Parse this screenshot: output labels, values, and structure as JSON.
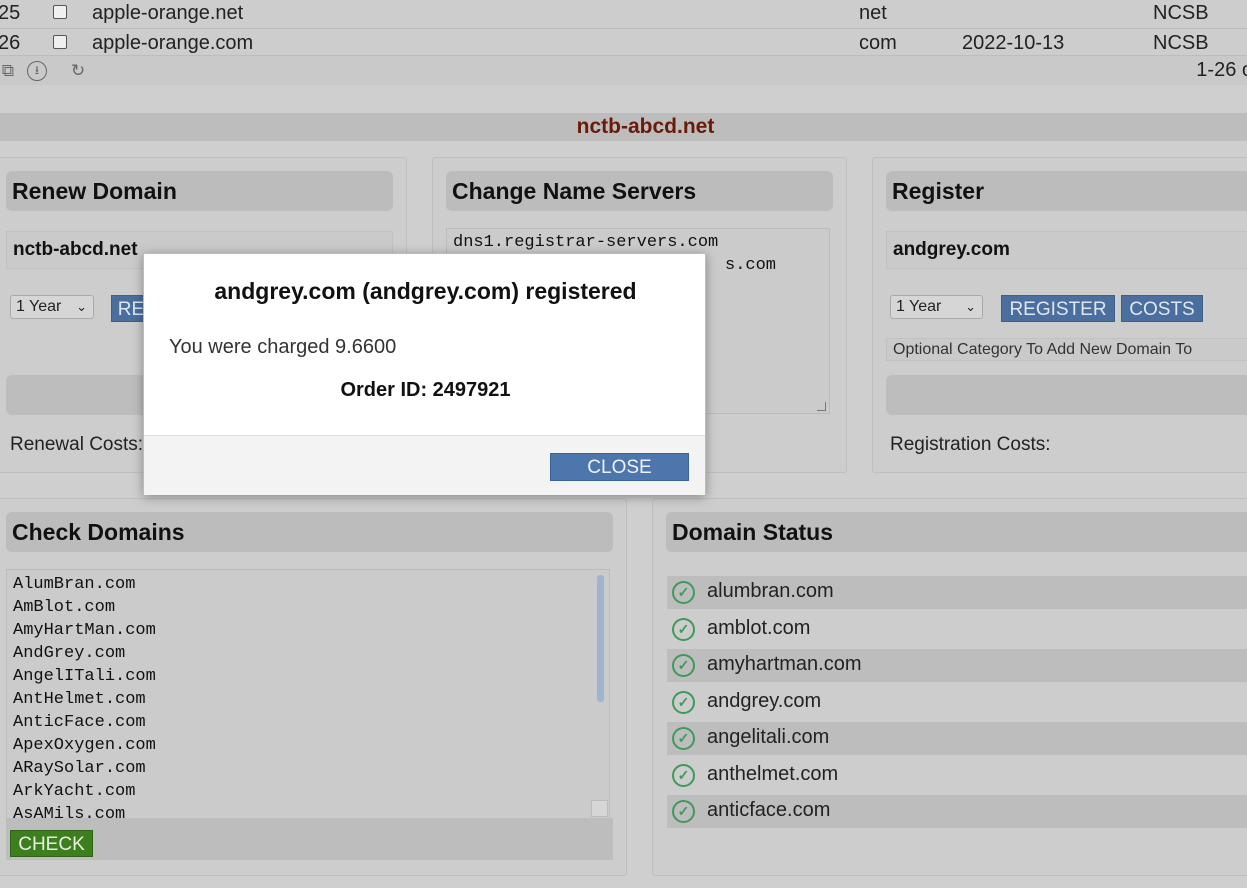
{
  "table": {
    "rows": [
      {
        "num": "25",
        "domain": "apple-orange.net",
        "tld": "net",
        "date": "",
        "registrar": "NCSB"
      },
      {
        "num": "26",
        "domain": "apple-orange.com",
        "tld": "com",
        "date": "2022-10-13",
        "registrar": "NCSB"
      }
    ],
    "pager": "1-26 o"
  },
  "current_domain": "nctb-abcd.net",
  "renew": {
    "title": "Renew Domain",
    "domain": "nctb-abcd.net",
    "period": "1 Year",
    "button_partial": "RE",
    "costs_label": "Renewal Costs:"
  },
  "nameservers": {
    "title": "Change Name Servers",
    "line1": "dns1.registrar-servers.com",
    "line2": "s.com"
  },
  "register": {
    "title": "Register",
    "domain": "andgrey.com",
    "period": "1 Year",
    "register_label": "REGISTER",
    "costs_label": "COSTS",
    "category_placeholder": "Optional Category To Add New Domain To",
    "registration_costs_label": "Registration Costs:"
  },
  "check": {
    "title": "Check Domains",
    "domains": [
      "AlumBran.com",
      "AmBlot.com",
      "AmyHartMan.com",
      "AndGrey.com",
      "AngelITali.com",
      "AntHelmet.com",
      "AnticFace.com",
      "ApexOxygen.com",
      "ARaySolar.com",
      "ArkYacht.com",
      "AsAMils.com"
    ],
    "button": "CHECK"
  },
  "status": {
    "title": "Domain Status",
    "items": [
      "alumbran.com",
      "amblot.com",
      "amyhartman.com",
      "andgrey.com",
      "angelitali.com",
      "anthelmet.com",
      "anticface.com"
    ]
  },
  "modal": {
    "title": "andgrey.com (andgrey.com) registered",
    "charged": "You were charged 9.6600",
    "order": "Order ID: 2497921",
    "close": "CLOSE"
  }
}
